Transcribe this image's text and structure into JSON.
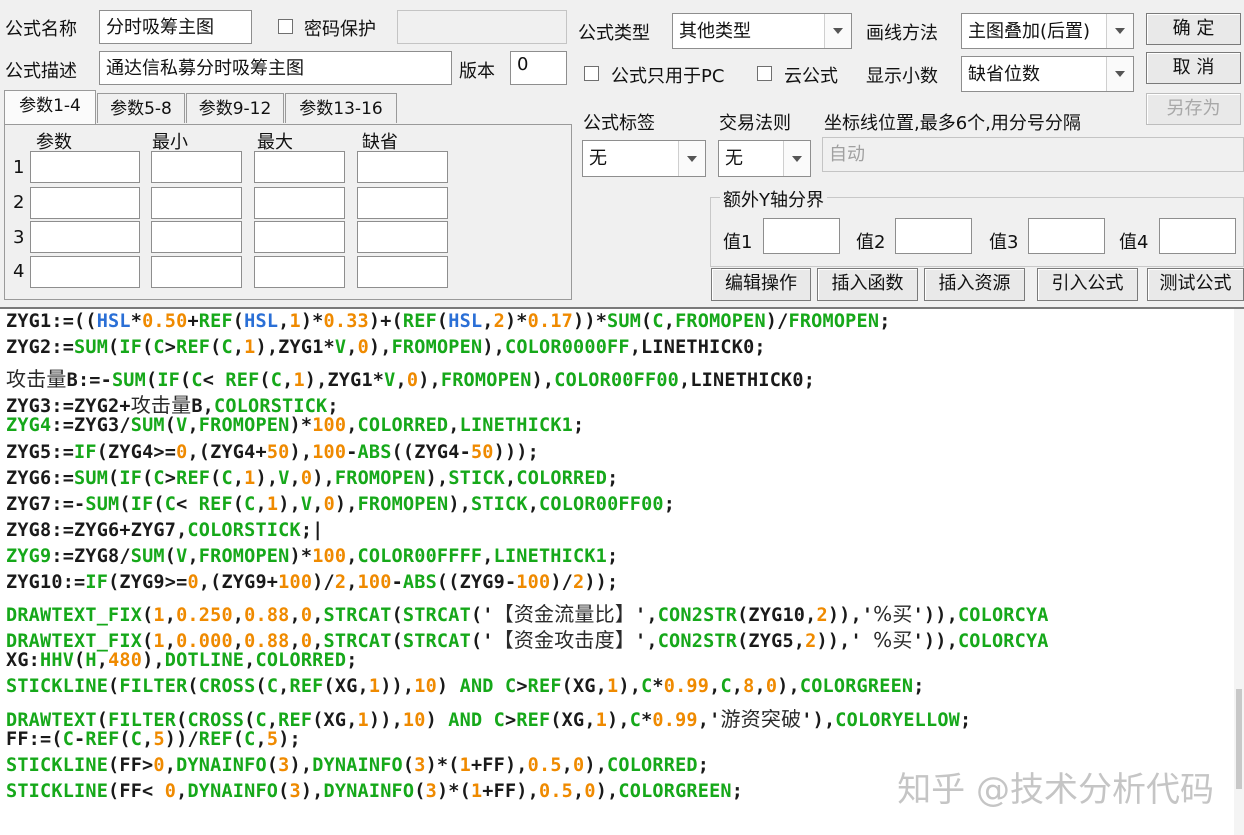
{
  "header": {
    "name_label": "公式名称",
    "name_value": "分时吸筹主图",
    "password_label": "密码保护",
    "password_value": "",
    "desc_label": "公式描述",
    "desc_value": "通达信私募分时吸筹主图",
    "version_label": "版本",
    "version_value": "0",
    "type_label": "公式类型",
    "type_value": "其他类型",
    "draw_label": "画线方法",
    "draw_value": "主图叠加(后置)",
    "pc_only_label": "公式只用于PC",
    "cloud_label": "云公式",
    "decimals_label": "显示小数",
    "decimals_value": "缺省位数"
  },
  "buttons": {
    "ok": "确 定",
    "cancel": "取 消",
    "save_as": "另存为",
    "edit": "编辑操作",
    "insert_func": "插入函数",
    "insert_res": "插入资源",
    "import": "引入公式",
    "test": "测试公式"
  },
  "params": {
    "tabs": [
      "参数1-4",
      "参数5-8",
      "参数9-12",
      "参数13-16"
    ],
    "columns": [
      "参数",
      "最小",
      "最大",
      "缺省"
    ],
    "rows": [
      "1",
      "2",
      "3",
      "4"
    ]
  },
  "options": {
    "tag_label": "公式标签",
    "tag_value": "无",
    "rule_label": "交易法则",
    "rule_value": "无",
    "axis_label": "坐标线位置,最多6个,用分号分隔",
    "axis_value": "自动",
    "yaxis_title": "额外Y轴分界",
    "y1": "值1",
    "y2": "值2",
    "y3": "值3",
    "y4": "值4"
  },
  "code": [
    [
      [
        "k",
        "ZYG1:=(("
      ],
      [
        "b",
        "HSL"
      ],
      [
        "k",
        "*"
      ],
      [
        "o",
        "0.50"
      ],
      [
        "k",
        "+"
      ],
      [
        "g",
        "REF"
      ],
      [
        "k",
        "("
      ],
      [
        "b",
        "HSL"
      ],
      [
        "k",
        ","
      ],
      [
        "o",
        "1"
      ],
      [
        "k",
        ")*"
      ],
      [
        "o",
        "0.33"
      ],
      [
        "k",
        ")+("
      ],
      [
        "g",
        "REF"
      ],
      [
        "k",
        "("
      ],
      [
        "b",
        "HSL"
      ],
      [
        "k",
        ","
      ],
      [
        "o",
        "2"
      ],
      [
        "k",
        ")*"
      ],
      [
        "o",
        "0.17"
      ],
      [
        "k",
        "))*"
      ],
      [
        "g",
        "SUM"
      ],
      [
        "k",
        "("
      ],
      [
        "g",
        "C"
      ],
      [
        "k",
        ","
      ],
      [
        "g",
        "FROMOPEN"
      ],
      [
        "k",
        ")/"
      ],
      [
        "g",
        "FROMOPEN"
      ],
      [
        "k",
        ";"
      ]
    ],
    [
      [
        "k",
        "ZYG2:="
      ],
      [
        "g",
        "SUM"
      ],
      [
        "k",
        "("
      ],
      [
        "g",
        "IF"
      ],
      [
        "k",
        "("
      ],
      [
        "g",
        "C"
      ],
      [
        "k",
        ">"
      ],
      [
        "g",
        "REF"
      ],
      [
        "k",
        "("
      ],
      [
        "g",
        "C"
      ],
      [
        "k",
        ","
      ],
      [
        "o",
        "1"
      ],
      [
        "k",
        "),ZYG1*"
      ],
      [
        "g",
        "V"
      ],
      [
        "k",
        ","
      ],
      [
        "o",
        "0"
      ],
      [
        "k",
        "),"
      ],
      [
        "g",
        "FROMOPEN"
      ],
      [
        "k",
        "),"
      ],
      [
        "g",
        "COLOR0000FF"
      ],
      [
        "k",
        ",LINETHICK0;"
      ]
    ],
    [
      [
        "c",
        "攻击量"
      ],
      [
        "k",
        "B:=-"
      ],
      [
        "g",
        "SUM"
      ],
      [
        "k",
        "("
      ],
      [
        "g",
        "IF"
      ],
      [
        "k",
        "("
      ],
      [
        "g",
        "C"
      ],
      [
        "k",
        "< "
      ],
      [
        "g",
        "REF"
      ],
      [
        "k",
        "("
      ],
      [
        "g",
        "C"
      ],
      [
        "k",
        ","
      ],
      [
        "o",
        "1"
      ],
      [
        "k",
        "),ZYG1*"
      ],
      [
        "g",
        "V"
      ],
      [
        "k",
        ","
      ],
      [
        "o",
        "0"
      ],
      [
        "k",
        "),"
      ],
      [
        "g",
        "FROMOPEN"
      ],
      [
        "k",
        "),"
      ],
      [
        "g",
        "COLOR00FF00"
      ],
      [
        "k",
        ",LINETHICK0;"
      ]
    ],
    [
      [
        "k",
        "ZYG3:=ZYG2+"
      ],
      [
        "c",
        "攻击量"
      ],
      [
        "k",
        "B,"
      ],
      [
        "g",
        "COLORSTICK"
      ],
      [
        "k",
        ";"
      ]
    ],
    [
      [
        "g",
        "ZYG4"
      ],
      [
        "k",
        ":=ZYG3/"
      ],
      [
        "g",
        "SUM"
      ],
      [
        "k",
        "("
      ],
      [
        "g",
        "V"
      ],
      [
        "k",
        ","
      ],
      [
        "g",
        "FROMOPEN"
      ],
      [
        "k",
        ")*"
      ],
      [
        "o",
        "100"
      ],
      [
        "k",
        ","
      ],
      [
        "g",
        "COLORRED"
      ],
      [
        "k",
        ","
      ],
      [
        "g",
        "LINETHICK1"
      ],
      [
        "k",
        ";"
      ]
    ],
    [
      [
        "k",
        "ZYG5:="
      ],
      [
        "g",
        "IF"
      ],
      [
        "k",
        "(ZYG4>="
      ],
      [
        "o",
        "0"
      ],
      [
        "k",
        ",(ZYG4+"
      ],
      [
        "o",
        "50"
      ],
      [
        "k",
        "),"
      ],
      [
        "o",
        "100"
      ],
      [
        "k",
        "-"
      ],
      [
        "g",
        "ABS"
      ],
      [
        "k",
        "((ZYG4-"
      ],
      [
        "o",
        "50"
      ],
      [
        "k",
        ")));"
      ]
    ],
    [
      [
        "k",
        "ZYG6:="
      ],
      [
        "g",
        "SUM"
      ],
      [
        "k",
        "("
      ],
      [
        "g",
        "IF"
      ],
      [
        "k",
        "("
      ],
      [
        "g",
        "C"
      ],
      [
        "k",
        ">"
      ],
      [
        "g",
        "REF"
      ],
      [
        "k",
        "("
      ],
      [
        "g",
        "C"
      ],
      [
        "k",
        ","
      ],
      [
        "o",
        "1"
      ],
      [
        "k",
        "),"
      ],
      [
        "g",
        "V"
      ],
      [
        "k",
        ","
      ],
      [
        "o",
        "0"
      ],
      [
        "k",
        "),"
      ],
      [
        "g",
        "FROMOPEN"
      ],
      [
        "k",
        "),"
      ],
      [
        "g",
        "STICK"
      ],
      [
        "k",
        ","
      ],
      [
        "g",
        "COLORRED"
      ],
      [
        "k",
        ";"
      ]
    ],
    [
      [
        "k",
        "ZYG7:=-"
      ],
      [
        "g",
        "SUM"
      ],
      [
        "k",
        "("
      ],
      [
        "g",
        "IF"
      ],
      [
        "k",
        "("
      ],
      [
        "g",
        "C"
      ],
      [
        "k",
        "< "
      ],
      [
        "g",
        "REF"
      ],
      [
        "k",
        "("
      ],
      [
        "g",
        "C"
      ],
      [
        "k",
        ","
      ],
      [
        "o",
        "1"
      ],
      [
        "k",
        "),"
      ],
      [
        "g",
        "V"
      ],
      [
        "k",
        ","
      ],
      [
        "o",
        "0"
      ],
      [
        "k",
        "),"
      ],
      [
        "g",
        "FROMOPEN"
      ],
      [
        "k",
        "),"
      ],
      [
        "g",
        "STICK"
      ],
      [
        "k",
        ","
      ],
      [
        "g",
        "COLOR00FF00"
      ],
      [
        "k",
        ";"
      ]
    ],
    [
      [
        "k",
        "ZYG8:=ZYG6+ZYG7,"
      ],
      [
        "g",
        "COLORSTICK"
      ],
      [
        "k",
        ";|"
      ]
    ],
    [
      [
        "g",
        "ZYG9"
      ],
      [
        "k",
        ":=ZYG8/"
      ],
      [
        "g",
        "SUM"
      ],
      [
        "k",
        "("
      ],
      [
        "g",
        "V"
      ],
      [
        "k",
        ","
      ],
      [
        "g",
        "FROMOPEN"
      ],
      [
        "k",
        ")*"
      ],
      [
        "o",
        "100"
      ],
      [
        "k",
        ","
      ],
      [
        "g",
        "COLOR00FFFF"
      ],
      [
        "k",
        ","
      ],
      [
        "g",
        "LINETHICK1"
      ],
      [
        "k",
        ";"
      ]
    ],
    [
      [
        "k",
        "ZYG10:="
      ],
      [
        "g",
        "IF"
      ],
      [
        "k",
        "(ZYG9>="
      ],
      [
        "o",
        "0"
      ],
      [
        "k",
        ",(ZYG9+"
      ],
      [
        "o",
        "100"
      ],
      [
        "k",
        ")/"
      ],
      [
        "o",
        "2"
      ],
      [
        "k",
        ","
      ],
      [
        "o",
        "100"
      ],
      [
        "k",
        "-"
      ],
      [
        "g",
        "ABS"
      ],
      [
        "k",
        "((ZYG9-"
      ],
      [
        "o",
        "100"
      ],
      [
        "k",
        ")/"
      ],
      [
        "o",
        "2"
      ],
      [
        "k",
        "));"
      ]
    ],
    [
      [
        "g",
        "DRAWTEXT_FIX"
      ],
      [
        "k",
        "("
      ],
      [
        "o",
        "1"
      ],
      [
        "k",
        ","
      ],
      [
        "o",
        "0.250"
      ],
      [
        "k",
        ","
      ],
      [
        "o",
        "0.88"
      ],
      [
        "k",
        ","
      ],
      [
        "o",
        "0"
      ],
      [
        "k",
        ","
      ],
      [
        "g",
        "STRCAT"
      ],
      [
        "k",
        "("
      ],
      [
        "g",
        "STRCAT"
      ],
      [
        "k",
        "('"
      ],
      [
        "c",
        "【资金流量比】"
      ],
      [
        "k",
        "',"
      ],
      [
        "g",
        "CON2STR"
      ],
      [
        "k",
        "(ZYG10,"
      ],
      [
        "o",
        "2"
      ],
      [
        "k",
        ")),'"
      ],
      [
        "c",
        "%买"
      ],
      [
        "k",
        "')),"
      ],
      [
        "g",
        "COLORCYA"
      ]
    ],
    [
      [
        "g",
        "DRAWTEXT_FIX"
      ],
      [
        "k",
        "("
      ],
      [
        "o",
        "1"
      ],
      [
        "k",
        ","
      ],
      [
        "o",
        "0.000"
      ],
      [
        "k",
        ","
      ],
      [
        "o",
        "0.88"
      ],
      [
        "k",
        ","
      ],
      [
        "o",
        "0"
      ],
      [
        "k",
        ","
      ],
      [
        "g",
        "STRCAT"
      ],
      [
        "k",
        "("
      ],
      [
        "g",
        "STRCAT"
      ],
      [
        "k",
        "('"
      ],
      [
        "c",
        "【资金攻击度】"
      ],
      [
        "k",
        "',"
      ],
      [
        "g",
        "CON2STR"
      ],
      [
        "k",
        "(ZYG5,"
      ],
      [
        "o",
        "2"
      ],
      [
        "k",
        ")),' "
      ],
      [
        "c",
        "%买"
      ],
      [
        "k",
        "')),"
      ],
      [
        "g",
        "COLORCYA"
      ]
    ],
    [
      [
        "k",
        "XG:"
      ],
      [
        "g",
        "HHV"
      ],
      [
        "k",
        "("
      ],
      [
        "g",
        "H"
      ],
      [
        "k",
        ","
      ],
      [
        "o",
        "480"
      ],
      [
        "k",
        "),"
      ],
      [
        "g",
        "DOTLINE"
      ],
      [
        "k",
        ","
      ],
      [
        "g",
        "COLORRED"
      ],
      [
        "k",
        ";"
      ]
    ],
    [
      [
        "g",
        "STICKLINE"
      ],
      [
        "k",
        "("
      ],
      [
        "g",
        "FILTER"
      ],
      [
        "k",
        "("
      ],
      [
        "g",
        "CROSS"
      ],
      [
        "k",
        "("
      ],
      [
        "g",
        "C"
      ],
      [
        "k",
        ","
      ],
      [
        "g",
        "REF"
      ],
      [
        "k",
        "(XG,"
      ],
      [
        "o",
        "1"
      ],
      [
        "k",
        ")),"
      ],
      [
        "o",
        "10"
      ],
      [
        "k",
        ") "
      ],
      [
        "g",
        "AND"
      ],
      [
        "k",
        " "
      ],
      [
        "g",
        "C"
      ],
      [
        "k",
        ">"
      ],
      [
        "g",
        "REF"
      ],
      [
        "k",
        "(XG,"
      ],
      [
        "o",
        "1"
      ],
      [
        "k",
        "),"
      ],
      [
        "g",
        "C"
      ],
      [
        "k",
        "*"
      ],
      [
        "o",
        "0.99"
      ],
      [
        "k",
        ","
      ],
      [
        "g",
        "C"
      ],
      [
        "k",
        ","
      ],
      [
        "o",
        "8"
      ],
      [
        "k",
        ","
      ],
      [
        "o",
        "0"
      ],
      [
        "k",
        "),"
      ],
      [
        "g",
        "COLORGREEN"
      ],
      [
        "k",
        ";"
      ]
    ],
    [
      [
        "g",
        "DRAWTEXT"
      ],
      [
        "k",
        "("
      ],
      [
        "g",
        "FILTER"
      ],
      [
        "k",
        "("
      ],
      [
        "g",
        "CROSS"
      ],
      [
        "k",
        "("
      ],
      [
        "g",
        "C"
      ],
      [
        "k",
        ","
      ],
      [
        "g",
        "REF"
      ],
      [
        "k",
        "(XG,"
      ],
      [
        "o",
        "1"
      ],
      [
        "k",
        ")),"
      ],
      [
        "o",
        "10"
      ],
      [
        "k",
        ") "
      ],
      [
        "g",
        "AND"
      ],
      [
        "k",
        " "
      ],
      [
        "g",
        "C"
      ],
      [
        "k",
        ">"
      ],
      [
        "g",
        "REF"
      ],
      [
        "k",
        "(XG,"
      ],
      [
        "o",
        "1"
      ],
      [
        "k",
        "),"
      ],
      [
        "g",
        "C"
      ],
      [
        "k",
        "*"
      ],
      [
        "o",
        "0.99"
      ],
      [
        "k",
        ",'"
      ],
      [
        "c",
        "游资突破"
      ],
      [
        "k",
        "'),"
      ],
      [
        "g",
        "COLORYELLOW"
      ],
      [
        "k",
        ";"
      ]
    ],
    [
      [
        "k",
        "FF:=("
      ],
      [
        "g",
        "C"
      ],
      [
        "k",
        "-"
      ],
      [
        "g",
        "REF"
      ],
      [
        "k",
        "("
      ],
      [
        "g",
        "C"
      ],
      [
        "k",
        ","
      ],
      [
        "o",
        "5"
      ],
      [
        "k",
        "))/"
      ],
      [
        "g",
        "REF"
      ],
      [
        "k",
        "("
      ],
      [
        "g",
        "C"
      ],
      [
        "k",
        ","
      ],
      [
        "o",
        "5"
      ],
      [
        "k",
        ");"
      ]
    ],
    [
      [
        "g",
        "STICKLINE"
      ],
      [
        "k",
        "(FF>"
      ],
      [
        "o",
        "0"
      ],
      [
        "k",
        ","
      ],
      [
        "g",
        "DYNAINFO"
      ],
      [
        "k",
        "("
      ],
      [
        "o",
        "3"
      ],
      [
        "k",
        "),"
      ],
      [
        "g",
        "DYNAINFO"
      ],
      [
        "k",
        "("
      ],
      [
        "o",
        "3"
      ],
      [
        "k",
        ")*("
      ],
      [
        "o",
        "1"
      ],
      [
        "k",
        "+FF),"
      ],
      [
        "o",
        "0.5"
      ],
      [
        "k",
        ","
      ],
      [
        "o",
        "0"
      ],
      [
        "k",
        "),"
      ],
      [
        "g",
        "COLORRED"
      ],
      [
        "k",
        ";"
      ]
    ],
    [
      [
        "g",
        "STICKLINE"
      ],
      [
        "k",
        "(FF< "
      ],
      [
        "o",
        "0"
      ],
      [
        "k",
        ","
      ],
      [
        "g",
        "DYNAINFO"
      ],
      [
        "k",
        "("
      ],
      [
        "o",
        "3"
      ],
      [
        "k",
        "),"
      ],
      [
        "g",
        "DYNAINFO"
      ],
      [
        "k",
        "("
      ],
      [
        "o",
        "3"
      ],
      [
        "k",
        ")*("
      ],
      [
        "o",
        "1"
      ],
      [
        "k",
        "+FF),"
      ],
      [
        "o",
        "0.5"
      ],
      [
        "k",
        ","
      ],
      [
        "o",
        "0"
      ],
      [
        "k",
        "),"
      ],
      [
        "g",
        "COLORGREEN"
      ],
      [
        "k",
        ";"
      ]
    ]
  ],
  "watermark": "知乎 @技术分析代码",
  "colors": {
    "keyword": "#16a81a",
    "number": "#ef8a00",
    "variable": "#2a6fd6",
    "text": "#1a1a1a"
  }
}
